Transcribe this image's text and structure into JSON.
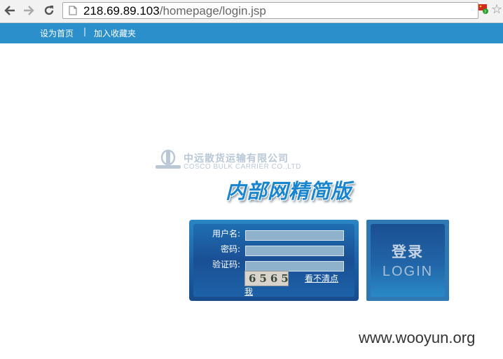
{
  "browser": {
    "url_host": "218.69.89.103",
    "url_path": "/homepage/login.jsp",
    "icons": {
      "back": "back-arrow-icon",
      "forward": "forward-arrow-icon",
      "reload": "reload-icon",
      "page": "page-icon",
      "extension": "flag-extension-icon",
      "bookmark": "bookmark-star-icon"
    }
  },
  "topbar": {
    "set_home": "设为首页",
    "separator": "|",
    "add_favorite": "加入收藏夹",
    "color": "#2b8fcb"
  },
  "logo": {
    "cn": "中远散货运输有限公司",
    "en": "COSCO BULK  CARRIER CO.,LTD"
  },
  "title": "内部网精简版",
  "form": {
    "username_label": "用户名:",
    "password_label": "密码:",
    "captcha_label": "验证码:",
    "username_value": "",
    "password_value": "",
    "captcha_value": "",
    "captcha_image_text": "6565",
    "refresh_text_line1": "看不清点",
    "refresh_text_line2": "我"
  },
  "login_button": {
    "cn": "登录",
    "en": "LOGIN"
  },
  "watermark": "www.wooyun.org"
}
